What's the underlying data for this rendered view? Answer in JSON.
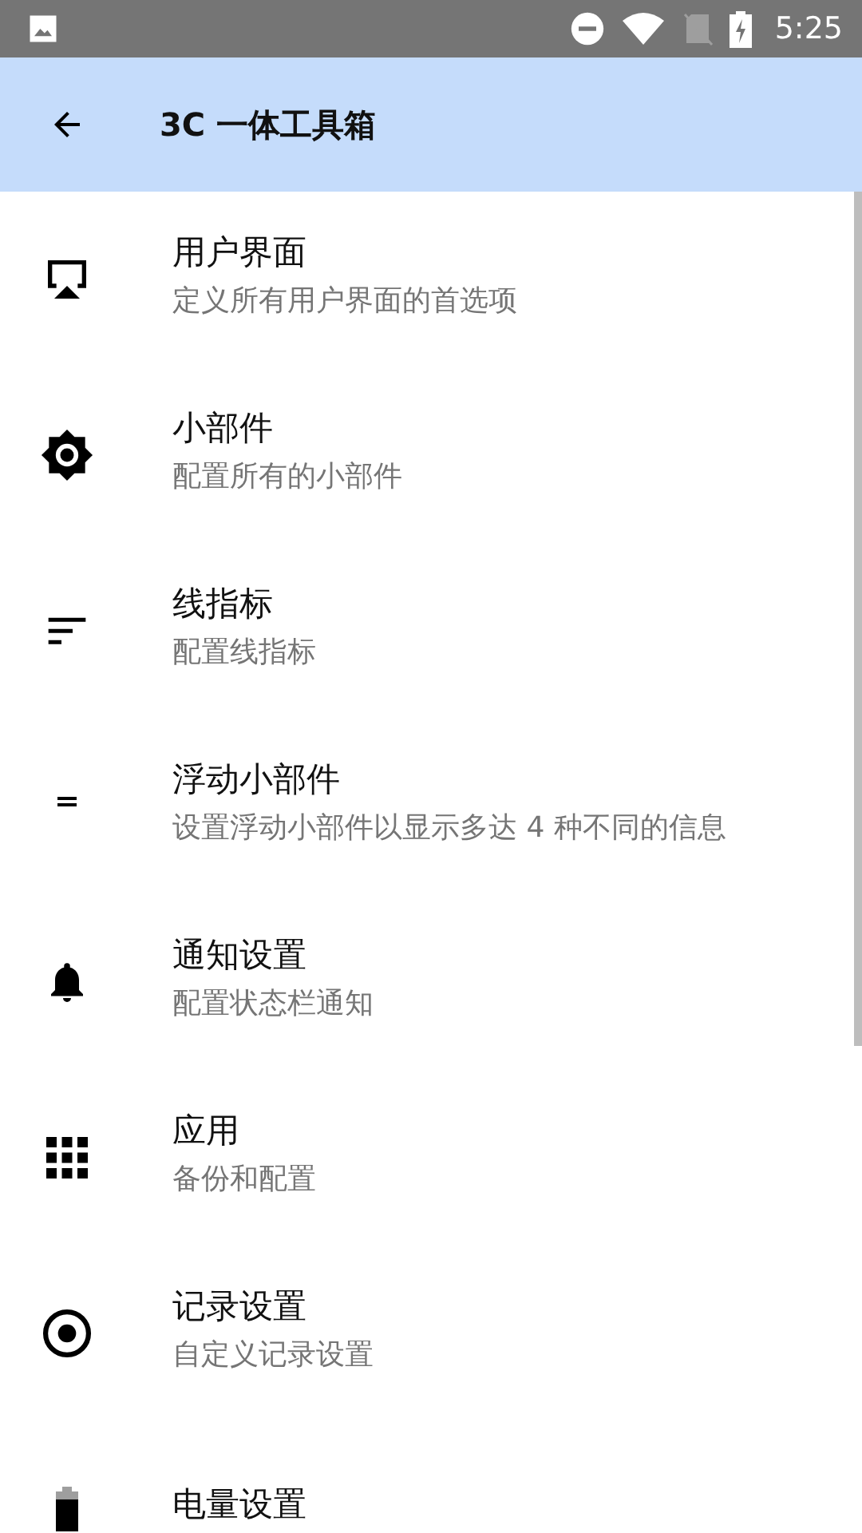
{
  "status_bar": {
    "time": "5:25"
  },
  "app_bar": {
    "title": "3C 一体工具箱"
  },
  "items": [
    {
      "title": "用户界面",
      "subtitle": "定义所有用户界面的首选项"
    },
    {
      "title": "小部件",
      "subtitle": "配置所有的小部件"
    },
    {
      "title": "线指标",
      "subtitle": "配置线指标"
    },
    {
      "title": "浮动小部件",
      "subtitle": "设置浮动小部件以显示多达 4 种不同的信息"
    },
    {
      "title": "通知设置",
      "subtitle": "配置状态栏通知"
    },
    {
      "title": "应用",
      "subtitle": "备份和配置"
    },
    {
      "title": "记录设置",
      "subtitle": "自定义记录设置"
    },
    {
      "title": "电量设置"
    }
  ]
}
